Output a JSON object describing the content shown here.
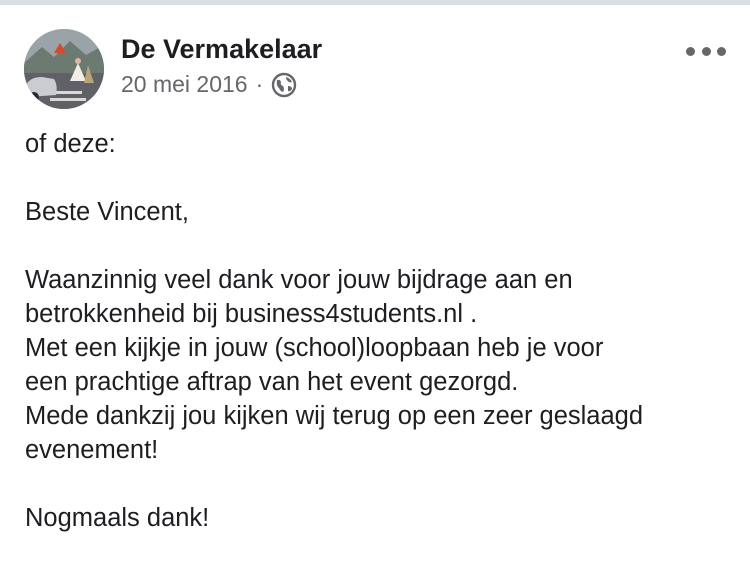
{
  "post": {
    "author": "De Vermakelaar",
    "date": "20 mei 2016",
    "separator": "·",
    "privacy_icon": "globe-icon",
    "more_icon": "more-options-icon",
    "body": {
      "line1": "of deze:",
      "line2": "Beste Vincent,",
      "line3": "Waanzinnig veel dank voor jouw bijdrage aan en",
      "line4": "betrokkenheid bij business4students.nl .",
      "line5": "Met een kijkje in jouw (school)loopbaan heb je voor",
      "line6": "een prachtige aftrap van het event gezorgd.",
      "line7": "Mede dankzij jou kijken wij terug op een zeer geslaagd",
      "line8": "evenement!",
      "line9": "Nogmaals dank!"
    }
  },
  "colors": {
    "text_primary": "#1c1e21",
    "text_secondary": "#65676b",
    "divider": "#dadde1"
  }
}
